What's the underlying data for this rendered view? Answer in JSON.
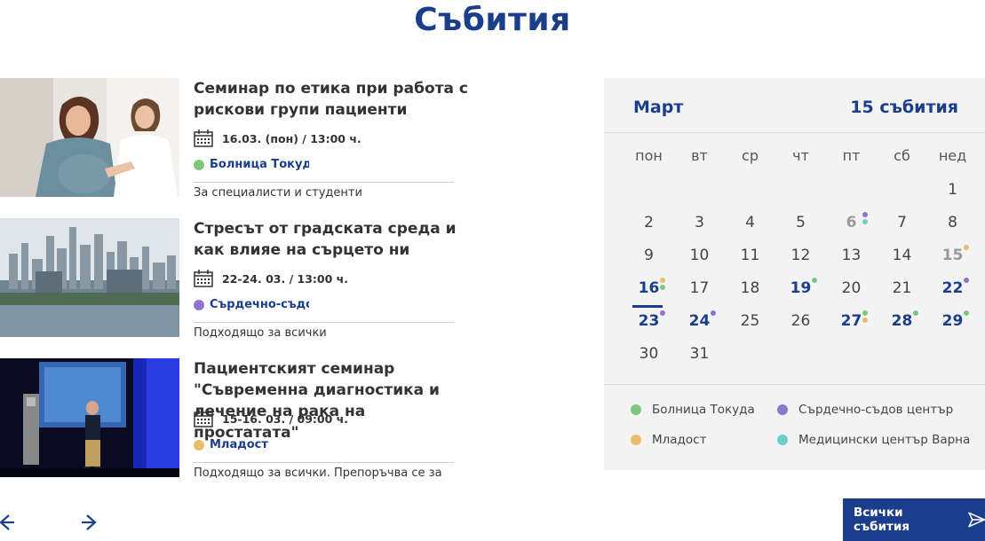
{
  "page": {
    "title": "Събития"
  },
  "events": [
    {
      "title": "Семинар по етика при работа с рискови групи пациенти",
      "date": "16.03. (пон) / 13:00 ч.",
      "location": "Болница Токуда",
      "location_color": "#7ec87e",
      "note": "За специалисти и студенти",
      "image": "doctor-patient-photo"
    },
    {
      "title": "Стресът от градската среда и как влияе на сърцето ни",
      "date": "22-24. 03. / 13:00 ч.",
      "location": "Сърдечно-съдов център",
      "location_color": "#8e76cc",
      "note": "Подходящо за всички",
      "image": "city-skyline-photo"
    },
    {
      "title": "Пациентският семинар \"Съвременна диагностика и лечение на рака на простатата\"",
      "date": "15-16. 03. / 09:00 ч.",
      "location": "Младост",
      "location_color": "#e8be6e",
      "note": "Подходящо за всички. Препоръчва се за",
      "image": "speaker-stage-photo"
    }
  ],
  "nav": {
    "prev_icon": "arrow-left-icon",
    "next_icon": "arrow-right-icon"
  },
  "calendar": {
    "month": "Март",
    "count": "15 събития",
    "weekdays": [
      "пон",
      "вт",
      "ср",
      "чт",
      "пт",
      "сб",
      "нед"
    ],
    "days": [
      {
        "d": "1"
      },
      {
        "d": "2"
      },
      {
        "d": "3"
      },
      {
        "d": "4"
      },
      {
        "d": "5"
      },
      {
        "d": "6",
        "state": "past",
        "markers": [
          "#8e76cc",
          "#6fcfcf"
        ]
      },
      {
        "d": "7"
      },
      {
        "d": "8"
      },
      {
        "d": "9"
      },
      {
        "d": "10"
      },
      {
        "d": "11"
      },
      {
        "d": "12"
      },
      {
        "d": "13"
      },
      {
        "d": "14"
      },
      {
        "d": "15",
        "state": "past",
        "markers": [
          "#e8be6e"
        ]
      },
      {
        "d": "16",
        "state": "ev",
        "today": true,
        "markers": [
          "#e8be6e",
          "#7ec87e"
        ]
      },
      {
        "d": "17"
      },
      {
        "d": "18"
      },
      {
        "d": "19",
        "state": "ev",
        "markers": [
          "#7ec87e"
        ]
      },
      {
        "d": "20"
      },
      {
        "d": "21"
      },
      {
        "d": "22",
        "state": "ev",
        "markers": [
          "#8e76cc"
        ]
      },
      {
        "d": "23",
        "state": "ev",
        "markers": [
          "#8e76cc"
        ]
      },
      {
        "d": "24",
        "state": "ev",
        "markers": [
          "#8e76cc"
        ]
      },
      {
        "d": "25"
      },
      {
        "d": "26"
      },
      {
        "d": "27",
        "state": "ev",
        "markers": [
          "#7ec87e",
          "#e8be6e"
        ]
      },
      {
        "d": "28",
        "state": "ev",
        "markers": [
          "#7ec87e"
        ]
      },
      {
        "d": "29",
        "state": "ev",
        "markers": [
          "#7ec87e"
        ]
      },
      {
        "d": "30"
      },
      {
        "d": "31"
      }
    ],
    "legend": [
      {
        "label": "Болница Токуда",
        "color": "#7ec87e"
      },
      {
        "label": "Сърдечно-съдов център",
        "color": "#8e76cc"
      },
      {
        "label": "Младост",
        "color": "#e8be6e"
      },
      {
        "label": "Медицински център Варна",
        "color": "#6fcfcf"
      }
    ]
  },
  "all_events_button": {
    "label": "Всички събития",
    "icon": "send-arrow-icon"
  },
  "colors": {
    "brand": "#1b3e8c",
    "panel": "#f3f3f3"
  }
}
